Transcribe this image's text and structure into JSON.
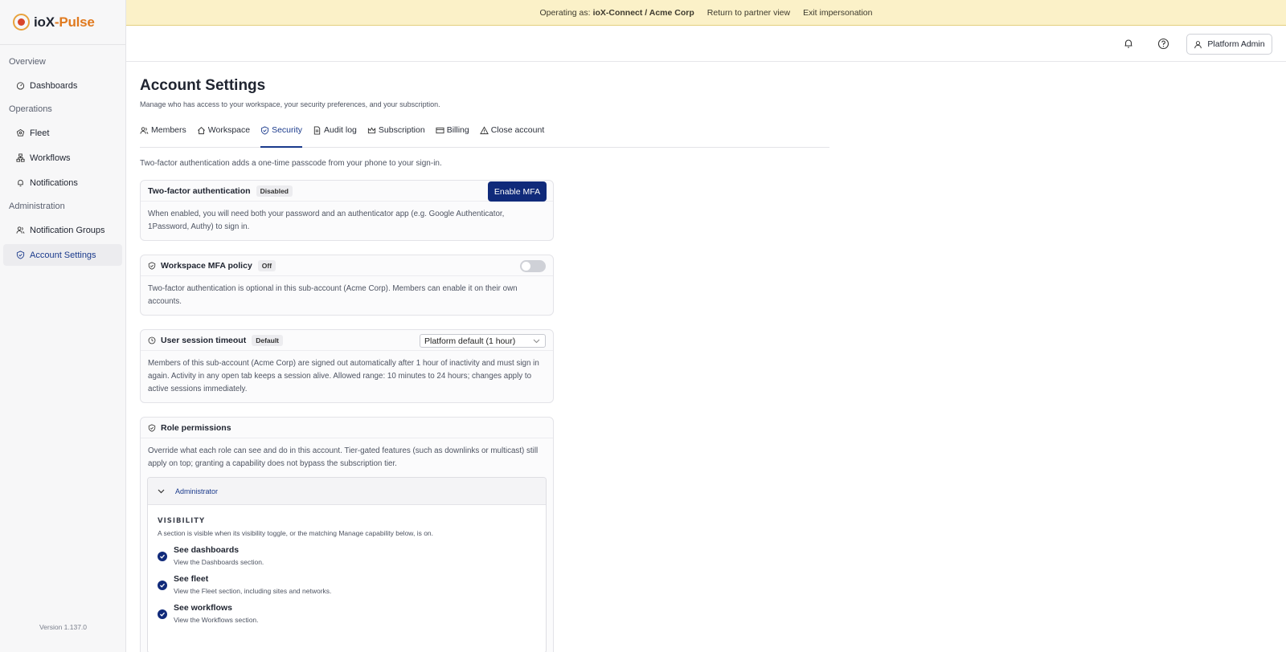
{
  "app": {
    "logo_a": "ioX",
    "logo_b": "-Pulse",
    "version": "Version 1.137.0"
  },
  "sidebar": {
    "sections": [
      {
        "label": "Overview",
        "items": [
          {
            "label": "Dashboards",
            "icon": "gauge-icon"
          }
        ]
      },
      {
        "label": "Operations",
        "items": [
          {
            "label": "Fleet",
            "icon": "fleet-icon"
          },
          {
            "label": "Workflows",
            "icon": "workflow-icon"
          },
          {
            "label": "Notifications",
            "icon": "bell-icon"
          }
        ]
      },
      {
        "label": "Administration",
        "items": [
          {
            "label": "Notification Groups",
            "icon": "users-icon"
          },
          {
            "label": "Account Settings",
            "icon": "shield-icon",
            "active": true
          }
        ]
      }
    ]
  },
  "banner": {
    "prefix": "Operating as:",
    "account": "ioX-Connect / Acme Corp",
    "return_label": "Return to partner view",
    "exit_label": "Exit impersonation"
  },
  "header": {
    "user_label": "Platform Admin"
  },
  "page": {
    "title": "Account Settings",
    "subtitle": "Manage who has access to your workspace, your security preferences, and your subscription.",
    "tabs": [
      {
        "label": "Members",
        "icon": "users-icon"
      },
      {
        "label": "Workspace",
        "icon": "home-icon"
      },
      {
        "label": "Security",
        "icon": "shield-icon",
        "active": true
      },
      {
        "label": "Audit log",
        "icon": "document-icon"
      },
      {
        "label": "Subscription",
        "icon": "crown-icon"
      },
      {
        "label": "Billing",
        "icon": "card-icon"
      },
      {
        "label": "Close account",
        "icon": "warning-icon"
      }
    ],
    "intro": "Two-factor authentication adds a one-time passcode from your phone to your sign-in."
  },
  "mfa": {
    "title": "Two-factor authentication",
    "status": "Disabled",
    "button": "Enable MFA",
    "body": "When enabled, you will need both your password and an authenticator app (e.g. Google Authenticator, 1Password, Authy) to sign in."
  },
  "policy": {
    "title": "Workspace MFA policy",
    "status": "Off",
    "enabled": false,
    "body": "Two-factor authentication is optional in this sub-account (Acme Corp). Members can enable it on their own accounts."
  },
  "timeout": {
    "title": "User session timeout",
    "status": "Default",
    "selected": "Platform default (1 hour)",
    "body": "Members of this sub-account (Acme Corp) are signed out automatically after 1 hour of inactivity and must sign in again. Activity in any open tab keeps a session alive. Allowed range: 10 minutes to 24 hours; changes apply to active sessions immediately."
  },
  "roles": {
    "title": "Role permissions",
    "body": "Override what each role can see and do in this account. Tier-gated features (such as downlinks or multicast) still apply on top; granting a capability does not bypass the subscription tier.",
    "role_name": "Administrator",
    "visibility_label": "VISIBILITY",
    "visibility_help": "A section is visible when its visibility toggle, or the matching Manage capability below, is on.",
    "permissions": [
      {
        "title": "See dashboards",
        "desc": "View the Dashboards section.",
        "checked": true
      },
      {
        "title": "See fleet",
        "desc": "View the Fleet section, including sites and networks.",
        "checked": true
      },
      {
        "title": "See workflows",
        "desc": "View the Workflows section.",
        "checked": true
      }
    ]
  }
}
